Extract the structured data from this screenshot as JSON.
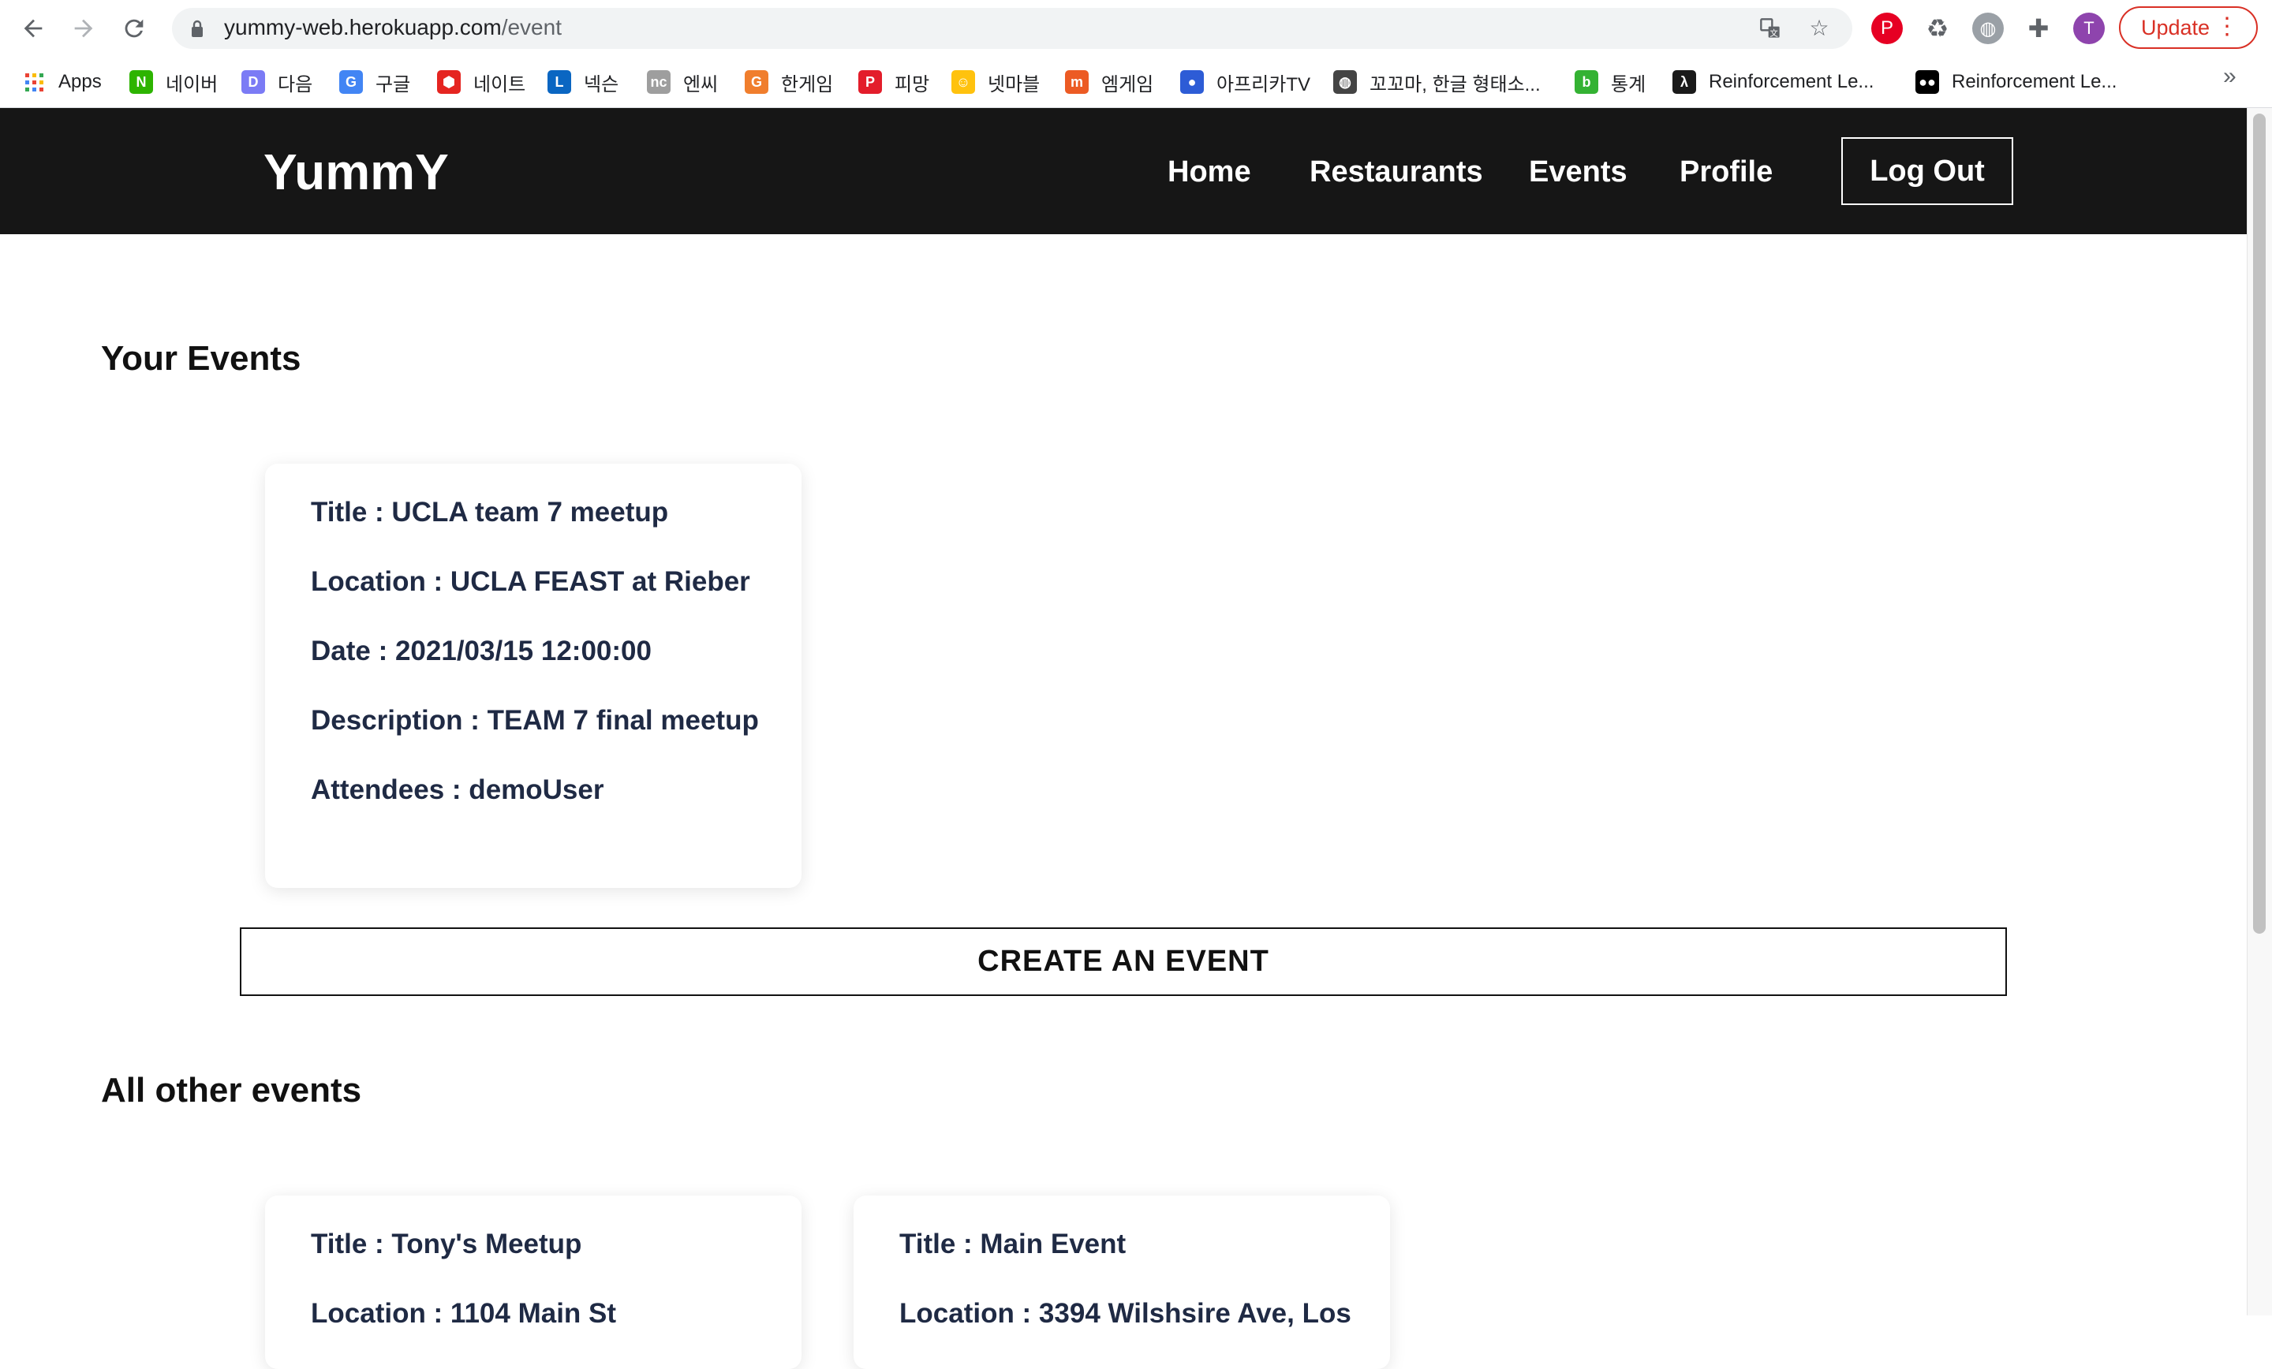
{
  "browser": {
    "url_host": "yummy-web.herokuapp.com",
    "url_path": "/event",
    "profile_initial": "T",
    "update_label": "Update"
  },
  "bookmarks": [
    {
      "label": "Apps",
      "icon": "apps-grid-icon",
      "color": "#4285f4"
    },
    {
      "label": "네이버",
      "icon": "naver-icon",
      "color": "#2db400",
      "glyph": "N"
    },
    {
      "label": "다음",
      "icon": "daum-icon",
      "color": "#7b7bf5",
      "glyph": "D"
    },
    {
      "label": "구글",
      "icon": "google-icon",
      "color": "#4285f4",
      "glyph": "G"
    },
    {
      "label": "네이트",
      "icon": "nate-icon",
      "color": "#e52521",
      "glyph": "⬢"
    },
    {
      "label": "넥슨",
      "icon": "nexon-icon",
      "color": "#0a66c2",
      "glyph": "L"
    },
    {
      "label": "엔씨",
      "icon": "ncsoft-icon",
      "color": "#9e9e9e",
      "glyph": "nc"
    },
    {
      "label": "한게임",
      "icon": "hangame-icon",
      "color": "#f07e2d",
      "glyph": "G"
    },
    {
      "label": "피망",
      "icon": "pmang-icon",
      "color": "#e31d2b",
      "glyph": "P"
    },
    {
      "label": "넷마블",
      "icon": "netmarble-icon",
      "color": "#ffc20e",
      "glyph": "☺"
    },
    {
      "label": "엠게임",
      "icon": "mgame-icon",
      "color": "#ec5b24",
      "glyph": "m"
    },
    {
      "label": "아프리카TV",
      "icon": "afreecatv-icon",
      "color": "#2d5cd6",
      "glyph": "●"
    },
    {
      "label": "꼬꼬마, 한글 형태소...",
      "icon": "globe-icon",
      "color": "#444444",
      "glyph": "◍"
    },
    {
      "label": "통계",
      "icon": "blog-icon",
      "color": "#34b233",
      "glyph": "b"
    },
    {
      "label": "Reinforcement Le...",
      "icon": "lambda-icon",
      "color": "#1a1a1a",
      "glyph": "λ"
    },
    {
      "label": "Reinforcement Le...",
      "icon": "medium-icon",
      "color": "#000000",
      "glyph": "●●"
    }
  ],
  "site": {
    "brand": "YummY",
    "nav": {
      "home": "Home",
      "restaurants": "Restaurants",
      "events": "Events",
      "profile": "Profile"
    },
    "logout": "Log Out"
  },
  "your_events": {
    "title": "Your Events",
    "events": [
      {
        "title": "Title : UCLA team 7 meetup",
        "location": "Location : UCLA FEAST at Rieber",
        "date": "Date : 2021/03/15 12:00:00",
        "description": "Description : TEAM 7 final meetup",
        "attendees": "Attendees : demoUser"
      }
    ]
  },
  "create_button": "CREATE AN EVENT",
  "other_events": {
    "title": "All other events",
    "events": [
      {
        "title": "Title : Tony's Meetup",
        "location": "Location : 1104 Main St"
      },
      {
        "title": "Title : Main Event",
        "location": "Location : 3394 Wilshsire Ave, Los"
      }
    ]
  }
}
